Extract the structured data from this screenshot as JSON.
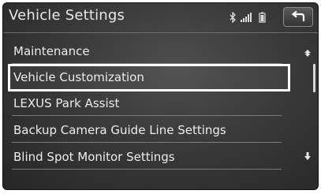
{
  "header": {
    "title": "Vehicle Settings",
    "status_icons": [
      "bluetooth-icon",
      "signal-strength-icon",
      "battery-icon"
    ],
    "back_icon": "back-arrow-icon"
  },
  "menu": {
    "items": [
      {
        "label": "Maintenance"
      },
      {
        "label": "Vehicle Customization",
        "selected": true
      },
      {
        "label": "LEXUS Park Assist"
      },
      {
        "label": "Backup Camera Guide Line Settings"
      },
      {
        "label": "Blind Spot Monitor Settings"
      }
    ]
  },
  "scroll": {
    "up_icon": "scroll-up-icon",
    "down_icon": "scroll-down-icon"
  },
  "colors": {
    "background": "#3a3a3a",
    "text": "#ececec",
    "highlight": "#ffffff"
  }
}
